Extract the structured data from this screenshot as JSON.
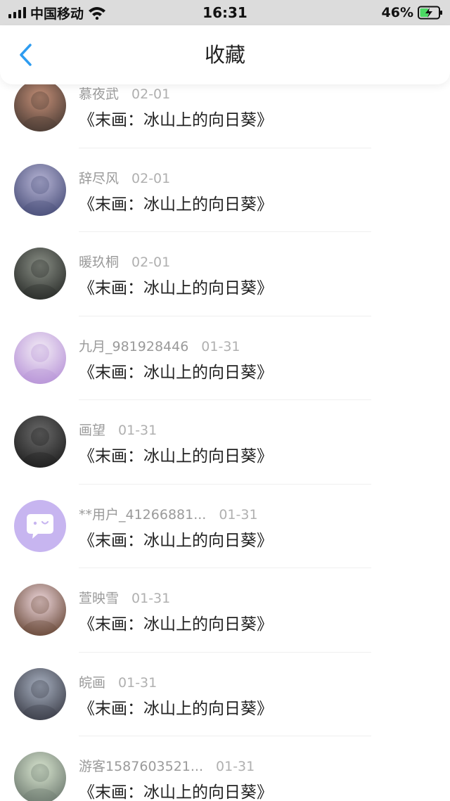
{
  "status_bar": {
    "carrier": "中国移动",
    "time": "16:31",
    "battery_percent": "46%",
    "battery_level": 0.46
  },
  "nav": {
    "title": "收藏",
    "back_icon": "chevron-left-icon"
  },
  "items": [
    {
      "user": "慕夜武",
      "date": "02-01",
      "title": "《末画：冰山上的向日葵》",
      "avatar_colors": [
        "#c69078",
        "#4a3b34"
      ]
    },
    {
      "user": "辞尽风",
      "date": "02-01",
      "title": "《末画：冰山上的向日葵》",
      "avatar_colors": [
        "#b8b6d6",
        "#4a4f7a"
      ]
    },
    {
      "user": "暖玖桐",
      "date": "02-01",
      "title": "《末画：冰山上的向日葵》",
      "avatar_colors": [
        "#8a8f86",
        "#2a2d2a"
      ]
    },
    {
      "user": "九月_981928446",
      "date": "01-31",
      "title": "《末画：冰山上的向日葵》",
      "avatar_colors": [
        "#f4eef6",
        "#b894d8"
      ]
    },
    {
      "user": "画望",
      "date": "01-31",
      "title": "《末画：冰山上的向日葵》",
      "avatar_colors": [
        "#6b6b6b",
        "#1f1f1f"
      ]
    },
    {
      "user": "**用户_41266881...",
      "date": "01-31",
      "title": "《末画：冰山上的向日葵》",
      "avatar_colors": [
        "#c7b5f0",
        "#ffffff"
      ]
    },
    {
      "user": "萱映雪",
      "date": "01-31",
      "title": "《末画：冰山上的向日葵》",
      "avatar_colors": [
        "#f0d9de",
        "#6a4a3a"
      ]
    },
    {
      "user": "皖画",
      "date": "01-31",
      "title": "《末画：冰山上的向日葵》",
      "avatar_colors": [
        "#a7b0c0",
        "#3d3f4a"
      ]
    },
    {
      "user": "游客1587603521...",
      "date": "01-31",
      "title": "《末画：冰山上的向日葵》",
      "avatar_colors": [
        "#d9e6d0",
        "#6e7a70"
      ]
    }
  ]
}
